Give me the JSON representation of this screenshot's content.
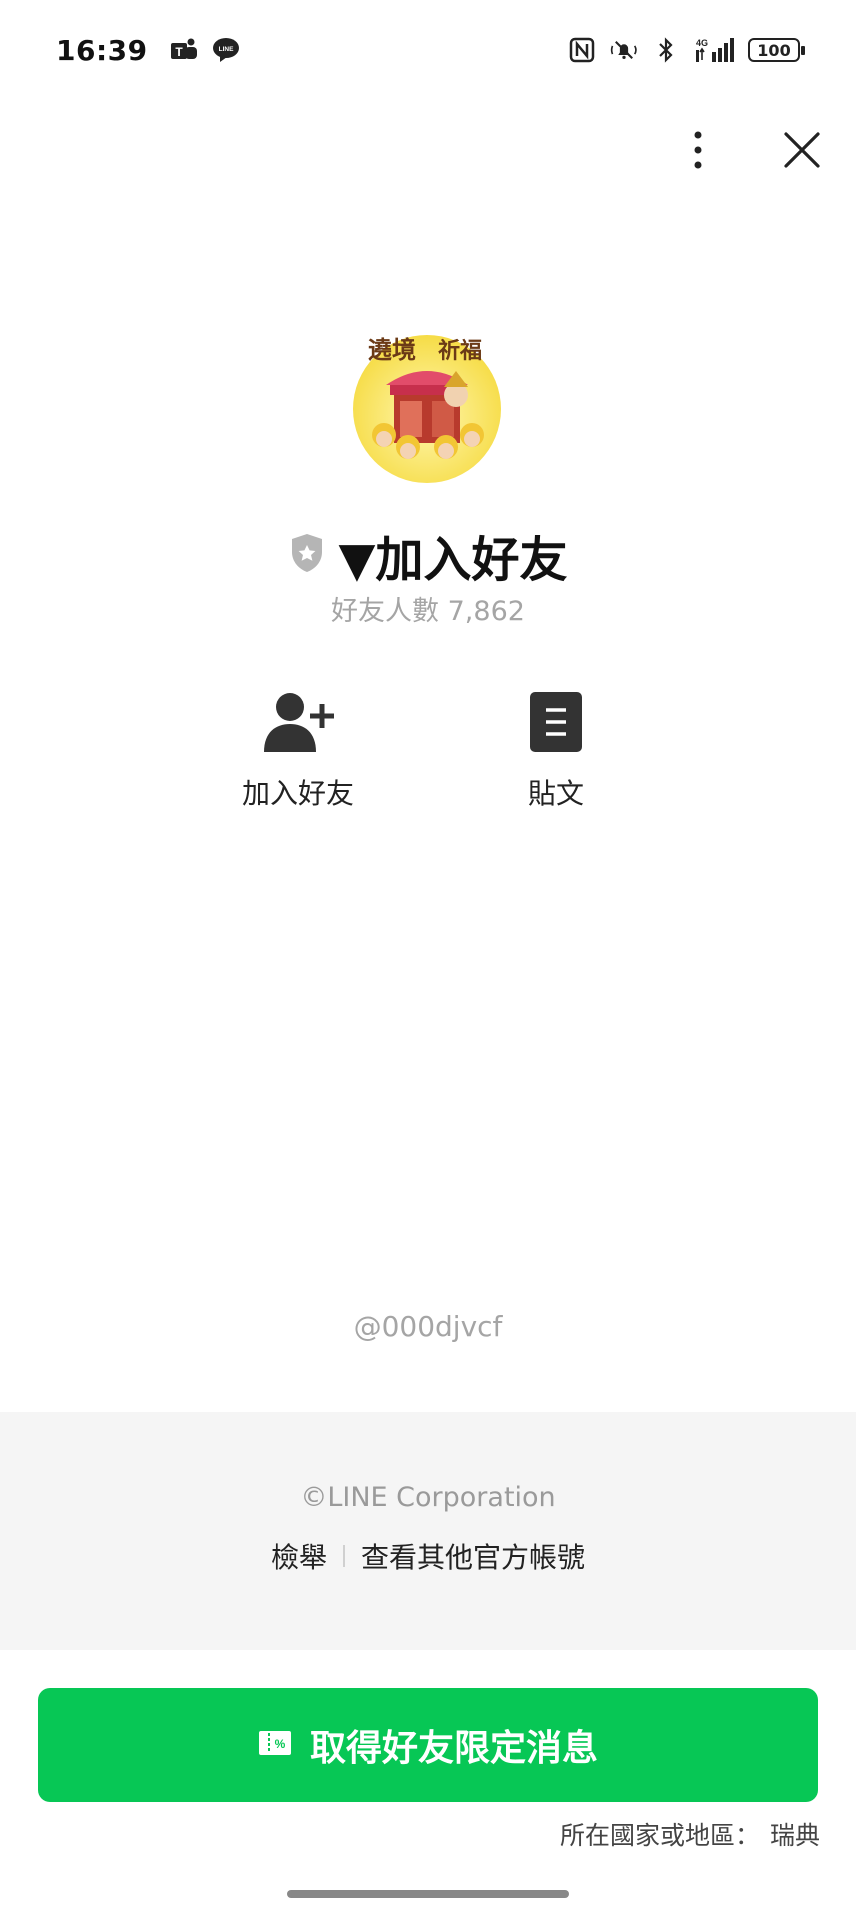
{
  "status_bar": {
    "time": "16:39",
    "battery": "100",
    "icons_left": [
      "teams-icon",
      "line-chat-icon"
    ],
    "icons_right": [
      "nfc-icon",
      "mute-icon",
      "bluetooth-icon",
      "signal-4g-icon",
      "battery-icon"
    ],
    "network_label": "4G"
  },
  "profile": {
    "name": "▼加入好友",
    "friend_count": "好友人數 7,862",
    "account_id": "@000djvcf",
    "badge_icon": "shield-star-icon"
  },
  "actions": [
    {
      "label": "加入好友",
      "icon": "add-friend-icon"
    },
    {
      "label": "貼文",
      "icon": "post-icon"
    }
  ],
  "footer": {
    "copyright": "©LINE Corporation",
    "report_link": "檢舉",
    "other_accounts_link": "查看其他官方帳號"
  },
  "cta": {
    "label": "取得好友限定消息",
    "icon": "coupon-icon",
    "color": "#07c755"
  },
  "region": {
    "label": "所在國家或地區：",
    "value": "瑞典"
  },
  "avatar": {
    "text_line1": "遶境",
    "text_line2": "祈福"
  }
}
